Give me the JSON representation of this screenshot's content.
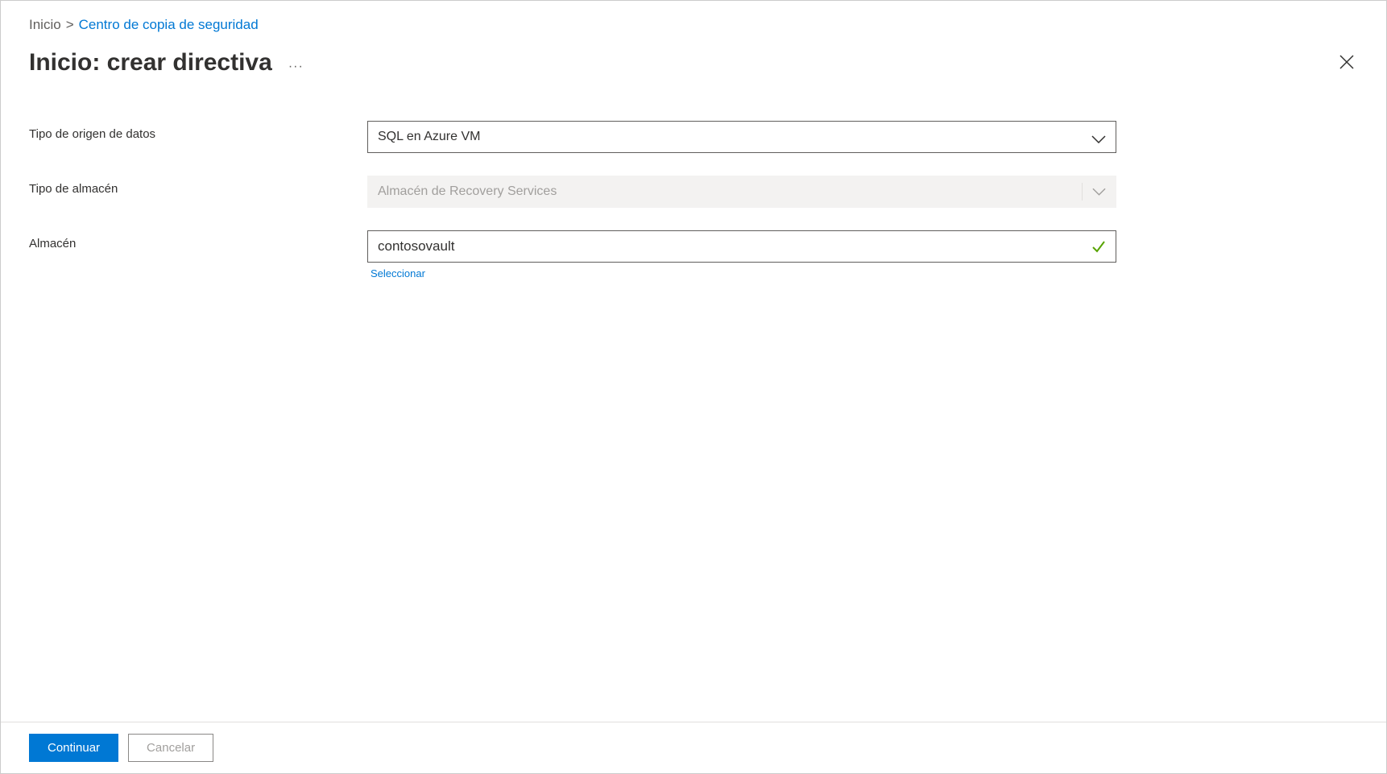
{
  "breadcrumb": {
    "home": "Inicio",
    "separator": ">",
    "link": "Centro de copia de seguridad"
  },
  "header": {
    "title": "Inicio: crear directiva",
    "ellipsis": "···"
  },
  "form": {
    "datasource_type": {
      "label": "Tipo de origen de datos",
      "value": "SQL en Azure VM"
    },
    "vault_type": {
      "label": "Tipo de almacén",
      "value": "Almacén de Recovery Services"
    },
    "vault": {
      "label": "Almacén",
      "value": "contosovault",
      "select_link": "Seleccionar"
    }
  },
  "footer": {
    "continue": "Continuar",
    "cancel": "Cancelar"
  }
}
